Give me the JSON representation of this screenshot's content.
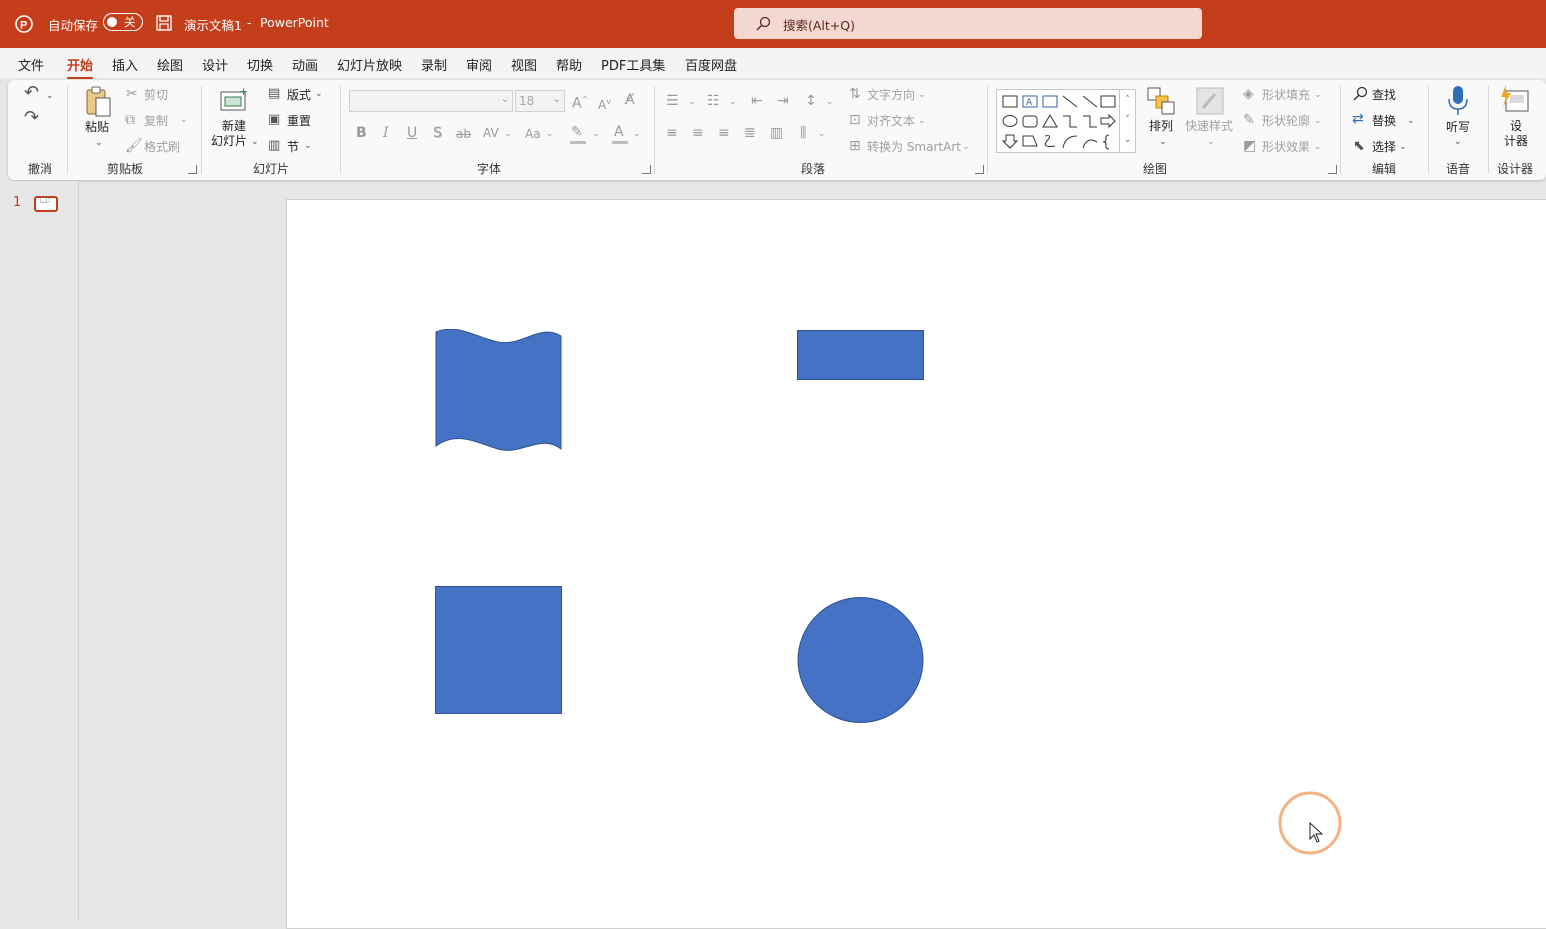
{
  "titlebar": {
    "autosave_label": "自动保存",
    "autosave_state": "关",
    "doc_title": "演示文稿1",
    "separator": "-",
    "app_name": "PowerPoint",
    "search_placeholder": "搜索(Alt+Q)",
    "bg_color": "#c43e1c"
  },
  "menu": {
    "tabs": [
      "文件",
      "开始",
      "插入",
      "绘图",
      "设计",
      "切换",
      "动画",
      "幻灯片放映",
      "录制",
      "审阅",
      "视图",
      "帮助",
      "PDF工具集",
      "百度网盘"
    ],
    "active": "开始"
  },
  "ribbon": {
    "groups": {
      "undo": "撤消",
      "clipboard": "剪贴板",
      "slides": "幻灯片",
      "font": "字体",
      "paragraph": "段落",
      "drawing": "绘图",
      "editing": "编辑",
      "voice": "语音",
      "designer": "设计器"
    },
    "clipboard": {
      "paste": "粘贴",
      "cut": "剪切",
      "copy": "复制",
      "format_painter": "格式刷"
    },
    "slides": {
      "new_slide_1": "新建",
      "new_slide_2": "幻灯片",
      "layout": "版式",
      "reset": "重置",
      "section": "节"
    },
    "font": {
      "size": "18",
      "bold": "B",
      "italic": "I",
      "underline": "U",
      "strike_s": "S",
      "strike_ab": "ab",
      "spacing": "AV",
      "case": "Aa",
      "color_a": "A"
    },
    "paragraph": {
      "text_direction": "文字方向",
      "align_text": "对齐文本",
      "smartart": "转换为 SmartArt"
    },
    "drawing": {
      "arrange": "排列",
      "quick_styles": "快速样式",
      "fill": "形状填充",
      "outline": "形状轮廓",
      "effects": "形状效果"
    },
    "editing": {
      "find": "查找",
      "replace": "替换",
      "select": "选择"
    },
    "voice": {
      "dictate": "听写"
    },
    "designer": {
      "label_1": "设",
      "label_2": "计器"
    }
  },
  "thumbnails": {
    "slide_number": "1"
  },
  "slide": {
    "shape_color": "#4472c4",
    "shape_outline": "#2f528f",
    "shapes": [
      "wave",
      "rectangle",
      "square",
      "circle"
    ]
  }
}
